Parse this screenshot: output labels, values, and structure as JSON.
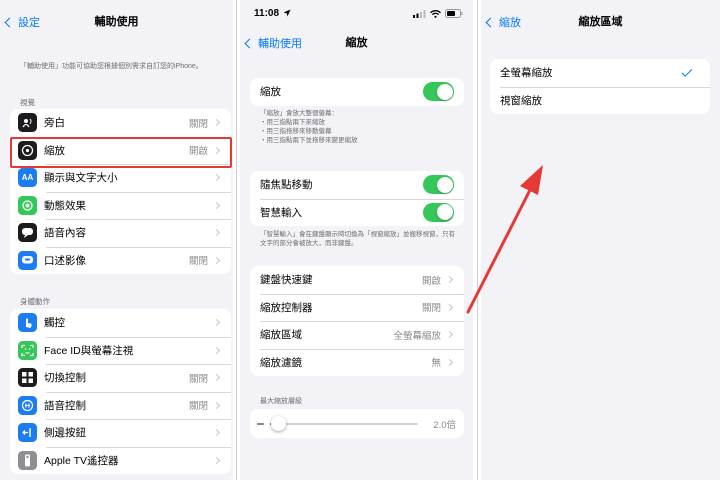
{
  "colors": {
    "accent": "#007aff",
    "toggle_on": "#34c759",
    "highlight": "#e53935",
    "arrow": "#e53935"
  },
  "panel1": {
    "back_label": "設定",
    "title": "輔助使用",
    "description": "「輔助使用」功能可協助您根據個別需求自訂您的iPhone。",
    "section_vision": "視覺",
    "vision_items": [
      {
        "label": "旁白",
        "value": "關閉",
        "icon": "voiceover-icon",
        "color": "#1c1c1e"
      },
      {
        "label": "縮放",
        "value": "開啟",
        "icon": "zoom-icon",
        "color": "#1c1c1e"
      },
      {
        "label": "顯示與文字大小",
        "value": "",
        "icon": "text-size-icon",
        "color": "#1e7cf2"
      },
      {
        "label": "動態效果",
        "value": "",
        "icon": "motion-icon",
        "color": "#34c759"
      },
      {
        "label": "語音內容",
        "value": "",
        "icon": "spoken-content-icon",
        "color": "#1c1c1e"
      },
      {
        "label": "口述影像",
        "value": "關閉",
        "icon": "audio-description-icon",
        "color": "#1e7cf2"
      }
    ],
    "section_physical": "身體動作",
    "physical_items": [
      {
        "label": "觸控",
        "value": "",
        "icon": "touch-icon",
        "color": "#1e7cf2"
      },
      {
        "label": "Face ID與螢幕注視",
        "value": "",
        "icon": "face-id-icon",
        "color": "#34c759"
      },
      {
        "label": "切換控制",
        "value": "關閉",
        "icon": "switch-control-icon",
        "color": "#1c1c1e"
      },
      {
        "label": "語音控制",
        "value": "關閉",
        "icon": "voice-control-icon",
        "color": "#1e7cf2"
      },
      {
        "label": "側邊按鈕",
        "value": "",
        "icon": "side-button-icon",
        "color": "#1e7cf2"
      },
      {
        "label": "Apple TV遙控器",
        "value": "",
        "icon": "tv-remote-icon",
        "color": "#8e8e93"
      }
    ]
  },
  "panel2": {
    "status_time": "11:08",
    "back_label": "輔助使用",
    "title": "縮放",
    "zoom_label": "縮放",
    "zoom_desc": "「縮放」會放大整個螢幕：\n・用三指點兩下來縮放\n・用三指拖移來移動螢幕\n・用三指點兩下並拖移來變更縮放",
    "follow_focus_label": "隨焦點移動",
    "smart_typing_label": "智慧輸入",
    "smart_typing_desc": "「智慧輸入」會在鍵盤顯示時切換為「視窗縮放」並搬移視窗，只有文字的部分會被放大，而非鍵盤。",
    "options": [
      {
        "label": "鍵盤快速鍵",
        "value": "開啟"
      },
      {
        "label": "縮放控制器",
        "value": "關閉"
      },
      {
        "label": "縮放區域",
        "value": "全螢幕縮放"
      },
      {
        "label": "縮放濾鏡",
        "value": "無"
      }
    ],
    "max_zoom_label": "最大縮放層級",
    "max_zoom_value": "2.0倍",
    "max_zoom_fraction": 0.06
  },
  "panel3": {
    "back_label": "縮放",
    "title": "縮放區域",
    "options": [
      {
        "label": "全螢幕縮放",
        "selected": true
      },
      {
        "label": "視窗縮放",
        "selected": false
      }
    ]
  }
}
